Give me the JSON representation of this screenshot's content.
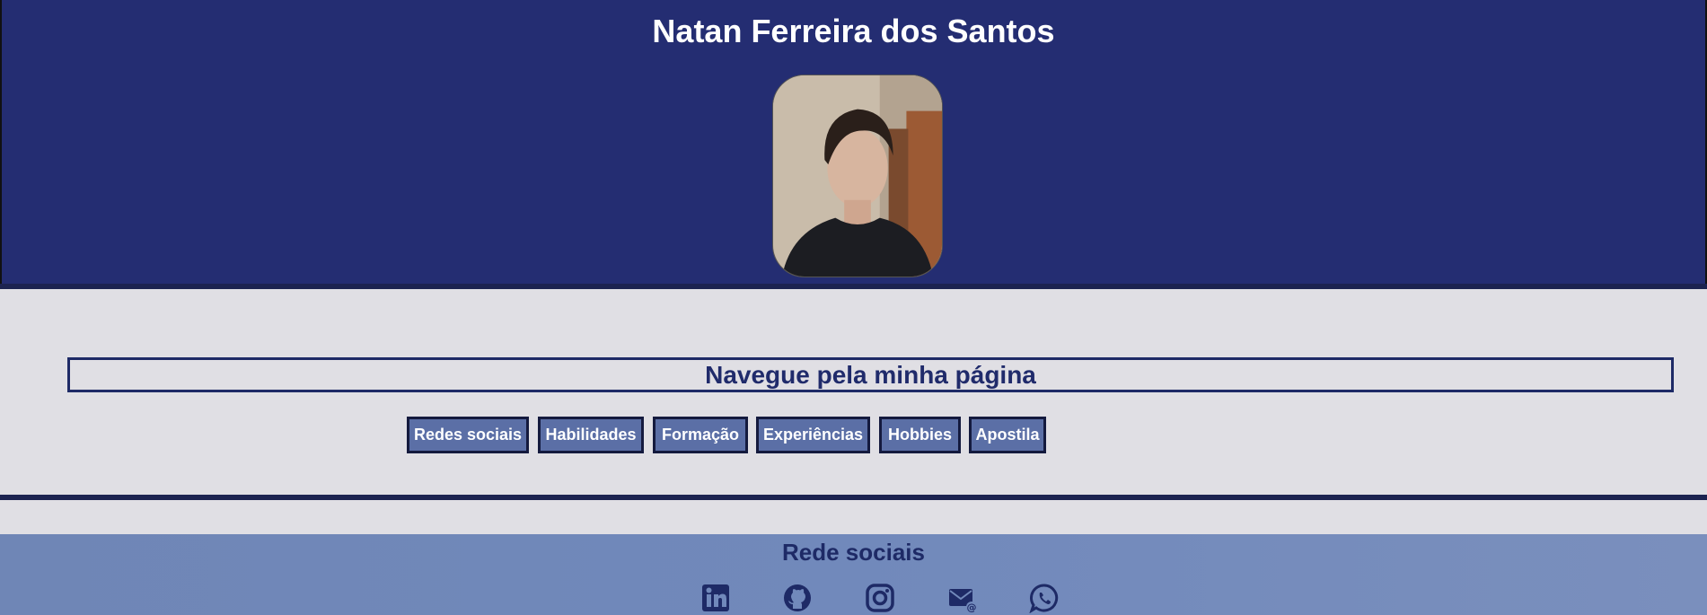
{
  "header": {
    "name": "Natan Ferreira dos Santos",
    "colors": {
      "background": "#242d72",
      "name_text": "#ffffff"
    }
  },
  "nav": {
    "title": "Navegue pela minha página",
    "buttons": [
      "Redes sociais",
      "Habilidades",
      "Formação",
      "Experiências",
      "Hobbies",
      "Apostila"
    ],
    "colors": {
      "button_bg": "#5b6fa6",
      "button_border": "#141a3e",
      "title": "#202b6b"
    }
  },
  "social": {
    "title": "Rede sociais",
    "icons": [
      "linkedin-icon",
      "github-icon",
      "instagram-icon",
      "email-icon",
      "whatsapp-icon"
    ],
    "colors": {
      "background": "#7189bb",
      "icon": "#1e2a66"
    }
  }
}
